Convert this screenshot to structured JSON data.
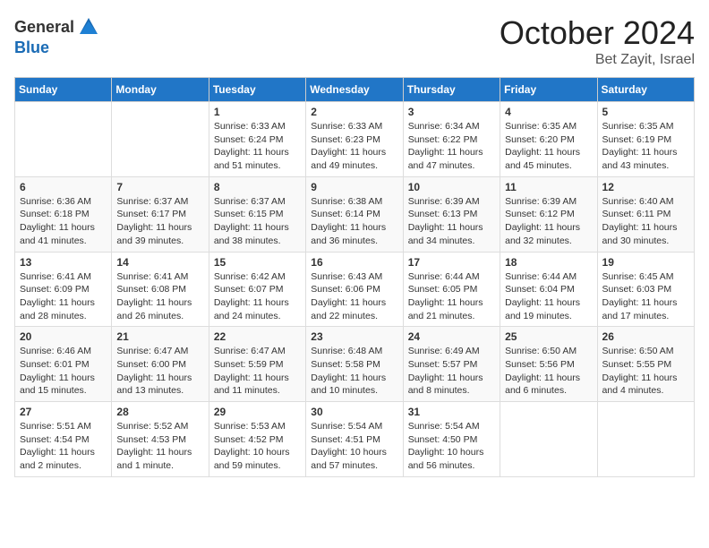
{
  "header": {
    "logo_general": "General",
    "logo_blue": "Blue",
    "month_title": "October 2024",
    "subtitle": "Bet Zayit, Israel"
  },
  "weekdays": [
    "Sunday",
    "Monday",
    "Tuesday",
    "Wednesday",
    "Thursday",
    "Friday",
    "Saturday"
  ],
  "weeks": [
    [
      {
        "day": "",
        "sunrise": "",
        "sunset": "",
        "daylight": ""
      },
      {
        "day": "",
        "sunrise": "",
        "sunset": "",
        "daylight": ""
      },
      {
        "day": "1",
        "sunrise": "Sunrise: 6:33 AM",
        "sunset": "Sunset: 6:24 PM",
        "daylight": "Daylight: 11 hours and 51 minutes."
      },
      {
        "day": "2",
        "sunrise": "Sunrise: 6:33 AM",
        "sunset": "Sunset: 6:23 PM",
        "daylight": "Daylight: 11 hours and 49 minutes."
      },
      {
        "day": "3",
        "sunrise": "Sunrise: 6:34 AM",
        "sunset": "Sunset: 6:22 PM",
        "daylight": "Daylight: 11 hours and 47 minutes."
      },
      {
        "day": "4",
        "sunrise": "Sunrise: 6:35 AM",
        "sunset": "Sunset: 6:20 PM",
        "daylight": "Daylight: 11 hours and 45 minutes."
      },
      {
        "day": "5",
        "sunrise": "Sunrise: 6:35 AM",
        "sunset": "Sunset: 6:19 PM",
        "daylight": "Daylight: 11 hours and 43 minutes."
      }
    ],
    [
      {
        "day": "6",
        "sunrise": "Sunrise: 6:36 AM",
        "sunset": "Sunset: 6:18 PM",
        "daylight": "Daylight: 11 hours and 41 minutes."
      },
      {
        "day": "7",
        "sunrise": "Sunrise: 6:37 AM",
        "sunset": "Sunset: 6:17 PM",
        "daylight": "Daylight: 11 hours and 39 minutes."
      },
      {
        "day": "8",
        "sunrise": "Sunrise: 6:37 AM",
        "sunset": "Sunset: 6:15 PM",
        "daylight": "Daylight: 11 hours and 38 minutes."
      },
      {
        "day": "9",
        "sunrise": "Sunrise: 6:38 AM",
        "sunset": "Sunset: 6:14 PM",
        "daylight": "Daylight: 11 hours and 36 minutes."
      },
      {
        "day": "10",
        "sunrise": "Sunrise: 6:39 AM",
        "sunset": "Sunset: 6:13 PM",
        "daylight": "Daylight: 11 hours and 34 minutes."
      },
      {
        "day": "11",
        "sunrise": "Sunrise: 6:39 AM",
        "sunset": "Sunset: 6:12 PM",
        "daylight": "Daylight: 11 hours and 32 minutes."
      },
      {
        "day": "12",
        "sunrise": "Sunrise: 6:40 AM",
        "sunset": "Sunset: 6:11 PM",
        "daylight": "Daylight: 11 hours and 30 minutes."
      }
    ],
    [
      {
        "day": "13",
        "sunrise": "Sunrise: 6:41 AM",
        "sunset": "Sunset: 6:09 PM",
        "daylight": "Daylight: 11 hours and 28 minutes."
      },
      {
        "day": "14",
        "sunrise": "Sunrise: 6:41 AM",
        "sunset": "Sunset: 6:08 PM",
        "daylight": "Daylight: 11 hours and 26 minutes."
      },
      {
        "day": "15",
        "sunrise": "Sunrise: 6:42 AM",
        "sunset": "Sunset: 6:07 PM",
        "daylight": "Daylight: 11 hours and 24 minutes."
      },
      {
        "day": "16",
        "sunrise": "Sunrise: 6:43 AM",
        "sunset": "Sunset: 6:06 PM",
        "daylight": "Daylight: 11 hours and 22 minutes."
      },
      {
        "day": "17",
        "sunrise": "Sunrise: 6:44 AM",
        "sunset": "Sunset: 6:05 PM",
        "daylight": "Daylight: 11 hours and 21 minutes."
      },
      {
        "day": "18",
        "sunrise": "Sunrise: 6:44 AM",
        "sunset": "Sunset: 6:04 PM",
        "daylight": "Daylight: 11 hours and 19 minutes."
      },
      {
        "day": "19",
        "sunrise": "Sunrise: 6:45 AM",
        "sunset": "Sunset: 6:03 PM",
        "daylight": "Daylight: 11 hours and 17 minutes."
      }
    ],
    [
      {
        "day": "20",
        "sunrise": "Sunrise: 6:46 AM",
        "sunset": "Sunset: 6:01 PM",
        "daylight": "Daylight: 11 hours and 15 minutes."
      },
      {
        "day": "21",
        "sunrise": "Sunrise: 6:47 AM",
        "sunset": "Sunset: 6:00 PM",
        "daylight": "Daylight: 11 hours and 13 minutes."
      },
      {
        "day": "22",
        "sunrise": "Sunrise: 6:47 AM",
        "sunset": "Sunset: 5:59 PM",
        "daylight": "Daylight: 11 hours and 11 minutes."
      },
      {
        "day": "23",
        "sunrise": "Sunrise: 6:48 AM",
        "sunset": "Sunset: 5:58 PM",
        "daylight": "Daylight: 11 hours and 10 minutes."
      },
      {
        "day": "24",
        "sunrise": "Sunrise: 6:49 AM",
        "sunset": "Sunset: 5:57 PM",
        "daylight": "Daylight: 11 hours and 8 minutes."
      },
      {
        "day": "25",
        "sunrise": "Sunrise: 6:50 AM",
        "sunset": "Sunset: 5:56 PM",
        "daylight": "Daylight: 11 hours and 6 minutes."
      },
      {
        "day": "26",
        "sunrise": "Sunrise: 6:50 AM",
        "sunset": "Sunset: 5:55 PM",
        "daylight": "Daylight: 11 hours and 4 minutes."
      }
    ],
    [
      {
        "day": "27",
        "sunrise": "Sunrise: 5:51 AM",
        "sunset": "Sunset: 4:54 PM",
        "daylight": "Daylight: 11 hours and 2 minutes."
      },
      {
        "day": "28",
        "sunrise": "Sunrise: 5:52 AM",
        "sunset": "Sunset: 4:53 PM",
        "daylight": "Daylight: 11 hours and 1 minute."
      },
      {
        "day": "29",
        "sunrise": "Sunrise: 5:53 AM",
        "sunset": "Sunset: 4:52 PM",
        "daylight": "Daylight: 10 hours and 59 minutes."
      },
      {
        "day": "30",
        "sunrise": "Sunrise: 5:54 AM",
        "sunset": "Sunset: 4:51 PM",
        "daylight": "Daylight: 10 hours and 57 minutes."
      },
      {
        "day": "31",
        "sunrise": "Sunrise: 5:54 AM",
        "sunset": "Sunset: 4:50 PM",
        "daylight": "Daylight: 10 hours and 56 minutes."
      },
      {
        "day": "",
        "sunrise": "",
        "sunset": "",
        "daylight": ""
      },
      {
        "day": "",
        "sunrise": "",
        "sunset": "",
        "daylight": ""
      }
    ]
  ]
}
